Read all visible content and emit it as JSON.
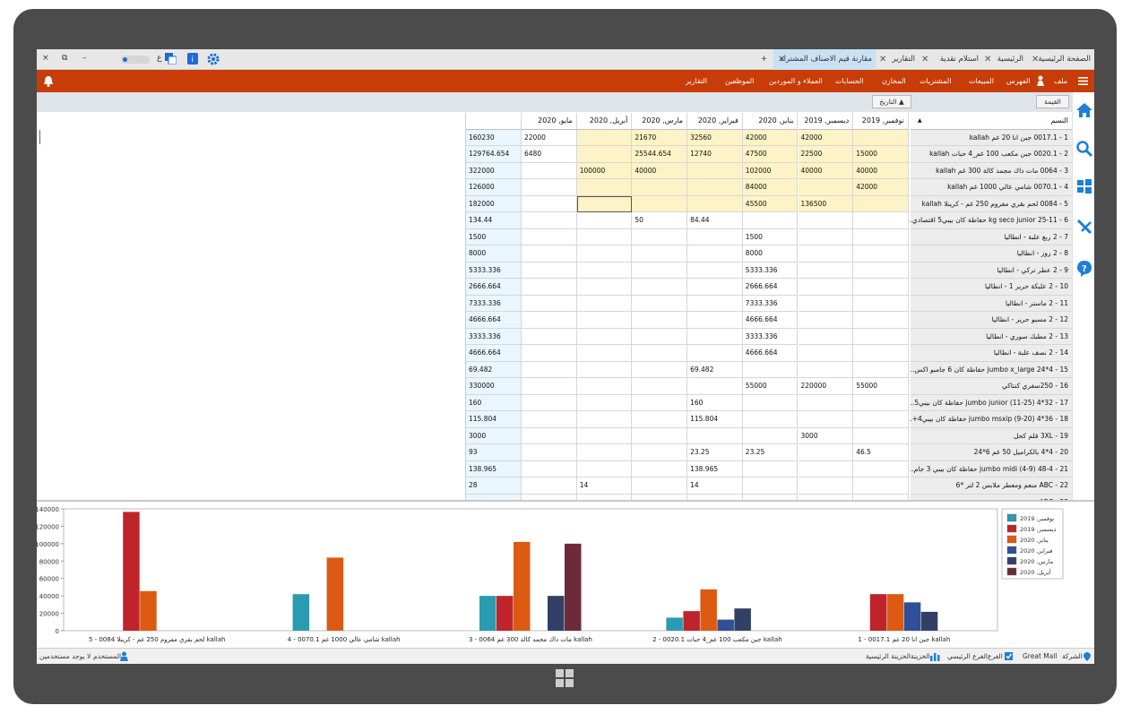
{
  "tabs": [
    {
      "label": "الصفحة الرئيسية",
      "active": false
    },
    {
      "label": "الرئيسية",
      "active": false
    },
    {
      "label": "استلام نقدية",
      "active": false
    },
    {
      "label": "التقارير",
      "active": false
    },
    {
      "label": "مقارنة قيم الاصناف المشتراه",
      "active": true
    },
    {
      "label": "+",
      "active": false
    }
  ],
  "window_controls": {
    "close": "×",
    "restore": "⧉",
    "minimize": "–",
    "lang": "ع"
  },
  "menu": {
    "items": [
      "ملف",
      "الفهرس",
      "المبيعات",
      "المشتريات",
      "المخازن",
      "الحسابات",
      "العملاء و الموردين",
      "الموظفين",
      "التقارير"
    ]
  },
  "filters": {
    "value_label": "القيمة",
    "date_label": "التاريخ ▲"
  },
  "grid": {
    "headers": [
      "النسم",
      "نوفمبر, 2019",
      "ديسمبر, 2019",
      "يناير, 2020",
      "فبراير, 2020",
      "مارس, 2020",
      "أبريل, 2020",
      "مايو, 2020",
      ""
    ],
    "sort_icon": "▲",
    "rows": [
      {
        "name": "1 - 0017.1 جبن انا 20 غم kallah",
        "vals": [
          "",
          "42000",
          "42000",
          "32560",
          "21670",
          "",
          "22000"
        ],
        "total": "160230",
        "hl": true
      },
      {
        "name": "2 - 0020.1 جبن مكعب 100 غم_4 حبات kallah",
        "vals": [
          "15000",
          "22500",
          "47500",
          "12740",
          "25544.654",
          "",
          "6480"
        ],
        "total": "129764.654",
        "hl": true
      },
      {
        "name": "3 - 0064 مات داك مجمد كالة 300 غم kallah",
        "vals": [
          "40000",
          "40000",
          "102000",
          "",
          "40000",
          "100000",
          ""
        ],
        "total": "322000",
        "hl": true
      },
      {
        "name": "4 - 0070.1 شامي عالي 1000 غم kallah",
        "vals": [
          "42000",
          "",
          "84000",
          "",
          "",
          "",
          ""
        ],
        "total": "126000",
        "hl": true
      },
      {
        "name": "5 - 0084 لحم بقري مفروم 250 غم - كرينلا kallah",
        "vals": [
          "",
          "136500",
          "45500",
          "",
          "",
          "",
          ""
        ],
        "total": "182000",
        "hl": true
      },
      {
        "name": "6 - 25-11 kg seco junior حفاظة كان بيبي5 اقتصادي...",
        "vals": [
          "",
          "",
          "",
          "84.44",
          "50",
          "",
          ""
        ],
        "total": "134.44",
        "hl": false
      },
      {
        "name": "7 - 2 ربع علبة - انطاليا",
        "vals": [
          "",
          "",
          "1500",
          "",
          "",
          "",
          ""
        ],
        "total": "1500",
        "hl": false
      },
      {
        "name": "8 - 2 زوز - انطاليا",
        "vals": [
          "",
          "",
          "8000",
          "",
          "",
          "",
          ""
        ],
        "total": "8000",
        "hl": false
      },
      {
        "name": "9 - 2 عطر تركي - انطاليا",
        "vals": [
          "",
          "",
          "5333.336",
          "",
          "",
          "",
          ""
        ],
        "total": "5333.336",
        "hl": false
      },
      {
        "name": "10 - 2 علبكة حرير 1 - انطاليا",
        "vals": [
          "",
          "",
          "2666.664",
          "",
          "",
          "",
          ""
        ],
        "total": "2666.664",
        "hl": false
      },
      {
        "name": "11 - 2 ماستر - انطاليا",
        "vals": [
          "",
          "",
          "7333.336",
          "",
          "",
          "",
          ""
        ],
        "total": "7333.336",
        "hl": false
      },
      {
        "name": "12 - 2 مسبو حرير - انطاليا",
        "vals": [
          "",
          "",
          "4666.664",
          "",
          "",
          "",
          ""
        ],
        "total": "4666.664",
        "hl": false
      },
      {
        "name": "13 - 2 مطبك سوري - انطاليا",
        "vals": [
          "",
          "",
          "3333.336",
          "",
          "",
          "",
          ""
        ],
        "total": "3333.336",
        "hl": false
      },
      {
        "name": "14 - 2 نصف علبة - انطاليا",
        "vals": [
          "",
          "",
          "4666.664",
          "",
          "",
          "",
          ""
        ],
        "total": "4666.664",
        "hl": false
      },
      {
        "name": "15 - 4*24 jumbo x_large حفاظة كان 6 جامبو اكس...",
        "vals": [
          "",
          "",
          "",
          "69.482",
          "",
          "",
          ""
        ],
        "total": "69.482",
        "hl": false
      },
      {
        "name": "16 - 250سفري كنتاكي",
        "vals": [
          "55000",
          "220000",
          "55000",
          "",
          "",
          "",
          ""
        ],
        "total": "330000",
        "hl": false
      },
      {
        "name": "17 - 32*4 (11-25) jumbo junior حفاظة كان بيبي5...",
        "vals": [
          "",
          "",
          "",
          "160",
          "",
          "",
          ""
        ],
        "total": "160",
        "hl": false
      },
      {
        "name": "18 - 36*4 (9-20) jumbo msxip حفاظة كان بيبي4+...",
        "vals": [
          "",
          "",
          "",
          "115.804",
          "",
          "",
          ""
        ],
        "total": "115.804",
        "hl": false
      },
      {
        "name": "19 - 3XL قلم كحل",
        "vals": [
          "",
          "3000",
          "",
          "",
          "",
          "",
          ""
        ],
        "total": "3000",
        "hl": false
      },
      {
        "name": "20 - 4*4 بالكراميل 50 غم 6*24",
        "vals": [
          "46.5",
          "",
          "23.25",
          "23.25",
          "",
          "",
          ""
        ],
        "total": "93",
        "hl": false
      },
      {
        "name": "21 - 48-4 (4-9) jumbo midi حفاظة كان بيبي 3 جام...",
        "vals": [
          "",
          "",
          "",
          "138.965",
          "",
          "",
          ""
        ],
        "total": "138.965",
        "hl": false
      },
      {
        "name": "22 - ABC منعم ومعطر ملابس 2 لتر *6",
        "vals": [
          "",
          "",
          "",
          "14",
          "",
          "14",
          ""
        ],
        "total": "28",
        "hl": false
      },
      {
        "name": "23 - ABC ...",
        "vals": [
          "",
          "",
          "",
          "",
          "",
          "",
          ""
        ],
        "total": "...",
        "hl": false
      }
    ]
  },
  "chart_data": {
    "type": "bar",
    "categories": [
      "1 - 0017.1 جبن انا 20 غم kallah",
      "2 - 0020.1 جبن مكعب 100 غم_4 حبات kallah",
      "3 - 0064 مات داك مجمد كالة 300 غم kallah",
      "4 - 0070.1 شامي عالي 1000 غم kallah",
      "5 - 0084 لحم بقري مفروم 250 غم - كرينلا kallah"
    ],
    "series": [
      {
        "name": "نوفمبر, 2019",
        "color": "#2a9bb0",
        "values": [
          0,
          15000,
          40000,
          42000,
          0
        ]
      },
      {
        "name": "ديسمبر, 2019",
        "color": "#c0242b",
        "values": [
          42000,
          22500,
          40000,
          0,
          136500
        ]
      },
      {
        "name": "يناير, 2020",
        "color": "#dc5a12",
        "values": [
          42000,
          47500,
          102000,
          84000,
          45500
        ]
      },
      {
        "name": "فبراير, 2020",
        "color": "#2f4f96",
        "values": [
          32560,
          12740,
          0,
          0,
          0
        ]
      },
      {
        "name": "مارس, 2020",
        "color": "#334066",
        "values": [
          21670,
          25544.654,
          40000,
          0,
          0
        ]
      },
      {
        "name": "أبريل, 2020",
        "color": "#6e2a3a",
        "values": [
          0,
          0,
          100000,
          0,
          0
        ]
      }
    ],
    "yticks": [
      "140000",
      "120000",
      "100000",
      "80000",
      "60000",
      "40000",
      "20000",
      "0"
    ],
    "ylim": [
      0,
      140000
    ],
    "legend": "right"
  },
  "status": {
    "company": "الشركة",
    "company_value": "Great Mall",
    "branch": "الفرع",
    "branch_value": "الفرع الرئيسي",
    "treasury": "الخزينة",
    "treasury_value": "الخزينة الرئيسية",
    "user": "المستخدم",
    "user_value": "لا يوجد مستخدمين"
  }
}
